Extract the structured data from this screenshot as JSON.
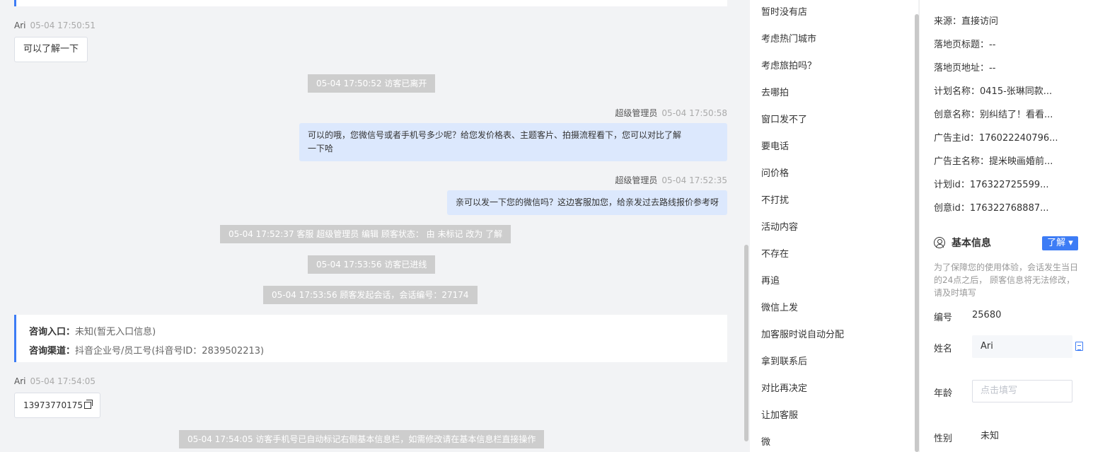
{
  "chat": {
    "m1": {
      "who": "Ari",
      "time": "05-04 17:50:51",
      "text": "可以了解一下"
    },
    "sys1": "05-04 17:50:52 访客已离开",
    "m2": {
      "who": "超级管理员",
      "time": "05-04 17:50:58",
      "text_line1": "可以的哦，您微信号或者手机号多少呢？给您发价格表、主题客片、拍摄流程看下，您可以对比了解",
      "text_line2": "一下哈"
    },
    "m3": {
      "who": "超级管理员",
      "time": "05-04 17:52:35",
      "text": "亲可以发一下您的微信吗？这边客服加您，给亲发过去路线报价参考呀"
    },
    "sys2": "05-04 17:52:37 客服 超级管理员 编辑 顾客状态： 由 未标记 改为 了解",
    "sys3": "05-04 17:53:56 访客已进线",
    "sys4": "05-04 17:53:56 顾客发起会话，会话编号：27174",
    "entry": {
      "label1": "咨询入口：",
      "value1": "未知(暂无入口信息)",
      "label2": "咨询渠道：",
      "value2": "抖音企业号/员工号(抖音号ID：2839502213)"
    },
    "m4": {
      "who": "Ari",
      "time": "05-04 17:54:05",
      "text": "13973770175"
    },
    "sys5": "05-04 17:54:05 访客手机号已自动标记右侧基本信息栏，如需修改请在基本信息栏直接操作"
  },
  "quick_replies": [
    "暂时没有店",
    "考虑热门城市",
    "考虑旅拍吗？",
    "去哪拍",
    "窗口发不了",
    "要电话",
    "问价格",
    "不打扰",
    "活动内容",
    "不存在",
    "再追",
    "微信上发",
    "加客服时说自动分配",
    "拿到联系后",
    "对比再决定",
    "让加客服",
    "微"
  ],
  "visitor": {
    "source": "来源：直接访问",
    "landing_title": "落地页标题：--",
    "landing_url": "落地页地址：--",
    "plan_name": "计划名称：0415-张琳同款...",
    "creative_name": "创意名称：别纠结了！看看...",
    "advertiser_id": "广告主id：176022240796...",
    "advertiser_name": "广告主名称：提米映画婚前...",
    "plan_id": "计划id：176322725599...",
    "creative_id": "创意id：176322768887..."
  },
  "basic": {
    "title": "基本信息",
    "tag": "了解 ▾",
    "tip": "为了保障您的使用体验，会话发生当日的24点之后， 顾客信息将无法修改，请及时填写",
    "no_label": "编号",
    "no_value": "25680",
    "name_label": "姓名",
    "name_value": "Ari",
    "age_label": "年龄",
    "age_placeholder": "点击填写",
    "gender_label": "性别",
    "gender_value": "未知"
  },
  "colors": {
    "accent": "#3d7cf5",
    "out_bubble": "#dce8fd",
    "system_msg": "#cdcdcd"
  }
}
